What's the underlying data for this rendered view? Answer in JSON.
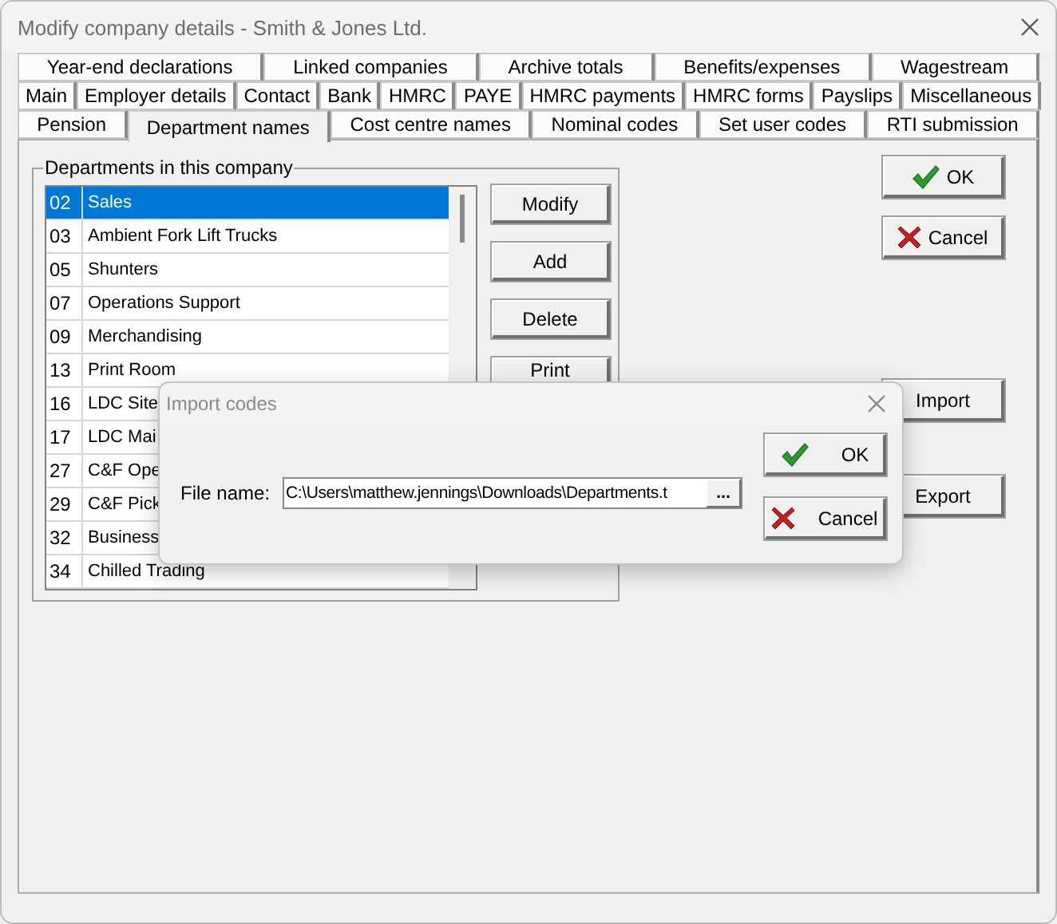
{
  "window": {
    "title": "Modify company details - Smith & Jones Ltd."
  },
  "tab_rows": [
    [
      {
        "label": "Year-end declarations",
        "selected": false
      },
      {
        "label": "Linked companies",
        "selected": false
      },
      {
        "label": "Archive totals",
        "selected": false
      },
      {
        "label": "Benefits/expenses",
        "selected": false
      },
      {
        "label": "Wagestream",
        "selected": false
      }
    ],
    [
      {
        "label": "Main",
        "selected": false
      },
      {
        "label": "Employer details",
        "selected": false
      },
      {
        "label": "Contact",
        "selected": false
      },
      {
        "label": "Bank",
        "selected": false
      },
      {
        "label": "HMRC",
        "selected": false
      },
      {
        "label": "PAYE",
        "selected": false
      },
      {
        "label": "HMRC payments",
        "selected": false
      },
      {
        "label": "HMRC forms",
        "selected": false
      },
      {
        "label": "Payslips",
        "selected": false
      },
      {
        "label": "Miscellaneous",
        "selected": false
      }
    ],
    [
      {
        "label": "Pension",
        "selected": false
      },
      {
        "label": "Department names",
        "selected": true
      },
      {
        "label": "Cost centre names",
        "selected": false
      },
      {
        "label": "Nominal codes",
        "selected": false
      },
      {
        "label": "Set user codes",
        "selected": false
      },
      {
        "label": "RTI submission",
        "selected": false
      }
    ]
  ],
  "departments": {
    "title": "Departments in this company",
    "rows": [
      {
        "code": "02",
        "name": "Sales",
        "selected": true
      },
      {
        "code": "03",
        "name": "Ambient Fork Lift Trucks",
        "selected": false
      },
      {
        "code": "05",
        "name": "Shunters",
        "selected": false
      },
      {
        "code": "07",
        "name": "Operations Support",
        "selected": false
      },
      {
        "code": "09",
        "name": "Merchandising",
        "selected": false
      },
      {
        "code": "13",
        "name": "Print Room",
        "selected": false
      },
      {
        "code": "16",
        "name": "LDC Site",
        "selected": false
      },
      {
        "code": "17",
        "name": "LDC Mai",
        "selected": false
      },
      {
        "code": "27",
        "name": "C&F Ope",
        "selected": false
      },
      {
        "code": "29",
        "name": "C&F Pick",
        "selected": false
      },
      {
        "code": "32",
        "name": "Business",
        "selected": false
      },
      {
        "code": "34",
        "name": "Chilled Trading",
        "selected": false
      }
    ],
    "buttons": [
      "Modify",
      "Add",
      "Delete",
      "Print"
    ]
  },
  "side_buttons": [
    {
      "label": "OK",
      "kind": "ok"
    },
    {
      "label": "Cancel",
      "kind": "cancel"
    },
    {
      "label": "Import",
      "kind": "plain"
    },
    {
      "label": "Export",
      "kind": "plain"
    }
  ],
  "import_dialog": {
    "title": "Import codes",
    "field_label": "File name:",
    "value": "C:\\Users\\matthew.jennings\\Downloads\\Departments.t",
    "browse": "...",
    "buttons": [
      {
        "label": "OK",
        "kind": "ok"
      },
      {
        "label": "Cancel",
        "kind": "cancel"
      }
    ]
  }
}
